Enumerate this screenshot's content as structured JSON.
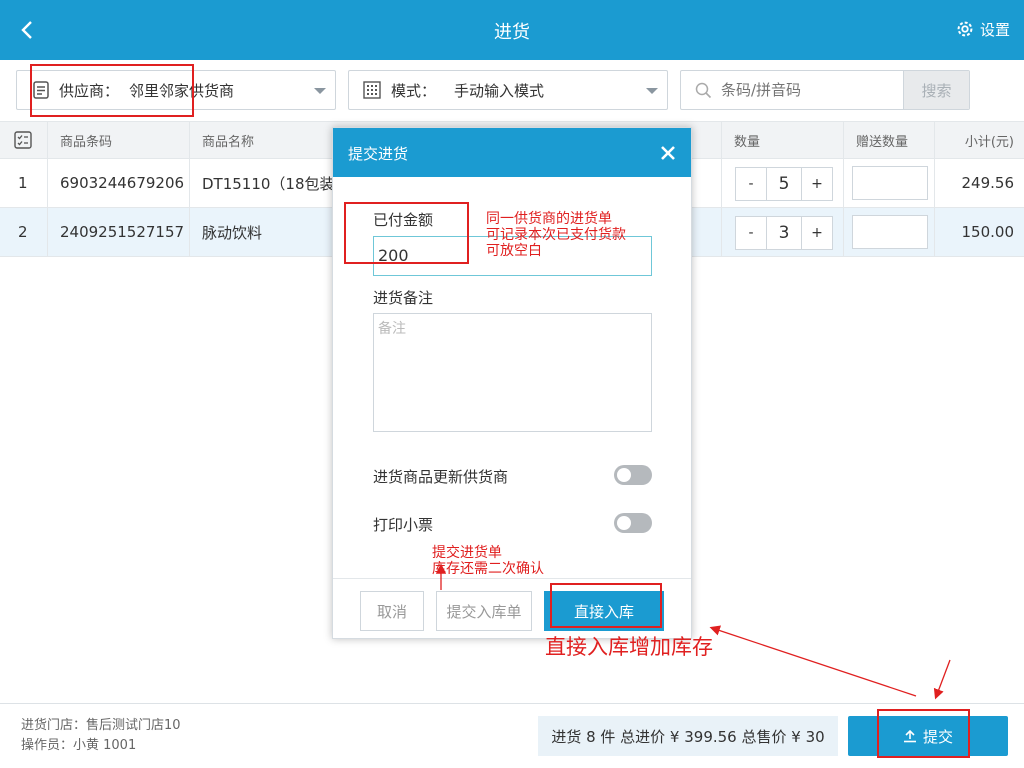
{
  "header": {
    "title": "进货",
    "settings_label": "设置"
  },
  "toolbar": {
    "supplier_label": "供应商：",
    "supplier_value": "邻里邻家供货商",
    "mode_label": "模式：",
    "mode_value": "手动输入模式",
    "search_placeholder": "条码/拼音码",
    "search_button": "搜索"
  },
  "table": {
    "columns": [
      "商品条码",
      "商品名称",
      "数量",
      "赠送数量",
      "小计(元)"
    ],
    "rows": [
      {
        "index": "1",
        "barcode": "6903244679206",
        "name": "DT15110（18包装",
        "qty": "5",
        "subtotal": "249.56"
      },
      {
        "index": "2",
        "barcode": "2409251527157",
        "name": "脉动饮料",
        "qty": "3",
        "subtotal": "150.00"
      }
    ]
  },
  "stepper": {
    "minus": "-",
    "plus": "+"
  },
  "modal": {
    "title": "提交进货",
    "paid_label": "已付金额",
    "paid_value": "200",
    "remark_label": "进货备注",
    "remark_placeholder": "备注",
    "update_supplier_label": "进货商品更新供货商",
    "print_receipt_label": "打印小票",
    "cancel": "取消",
    "submit_order": "提交入库单",
    "direct_stock": "直接入库"
  },
  "footer": {
    "store": "进货门店：售后测试门店10",
    "operator": "操作员：小黄 1001",
    "summary": "进货 8 件 总进价 ¥ 399.56 总售价 ¥ 30",
    "submit": "提交"
  },
  "annotations": {
    "paid_note": "同一供货商的进货单\n可记录本次已支付货款\n可放空白",
    "order_note": "提交进货单\n库存还需二次确认",
    "direct_note": "直接入库增加库存"
  },
  "colors": {
    "primary": "#1b9bd1",
    "annotation": "#e02020"
  }
}
